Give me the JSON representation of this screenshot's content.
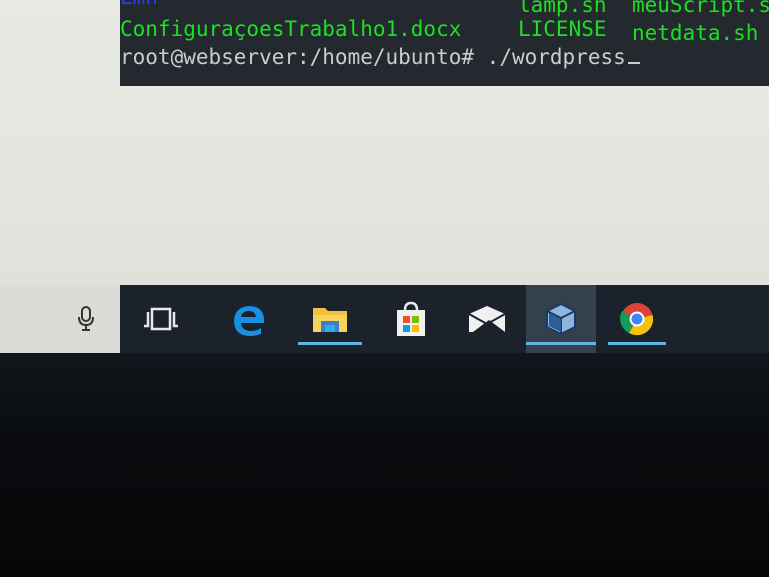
{
  "terminal": {
    "row0_files": [
      "Lmh",
      "lamp.sh",
      "meuScript.s"
    ],
    "row1_files": [
      "ConfiguraçoesTrabalho1.docx",
      "LICENSE",
      "netdata.sh"
    ],
    "prompt": "root@webserver:/home/ubunto#",
    "command": "./wordpress"
  },
  "taskbar": {
    "items": [
      {
        "icon": "microphone-icon"
      },
      {
        "icon": "task-view-icon"
      },
      {
        "icon": "edge-icon"
      },
      {
        "icon": "file-explorer-icon"
      },
      {
        "icon": "store-icon"
      },
      {
        "icon": "mail-icon"
      },
      {
        "icon": "virtualbox-icon"
      },
      {
        "icon": "chrome-icon"
      }
    ]
  },
  "colors": {
    "terminal_bg": "#24282f",
    "terminal_green": "#19e21f",
    "terminal_blue": "#2a3bff",
    "terminal_text": "#c9ccd0",
    "taskbar_bg": "#1c222b",
    "indicator": "#5fb7df"
  }
}
